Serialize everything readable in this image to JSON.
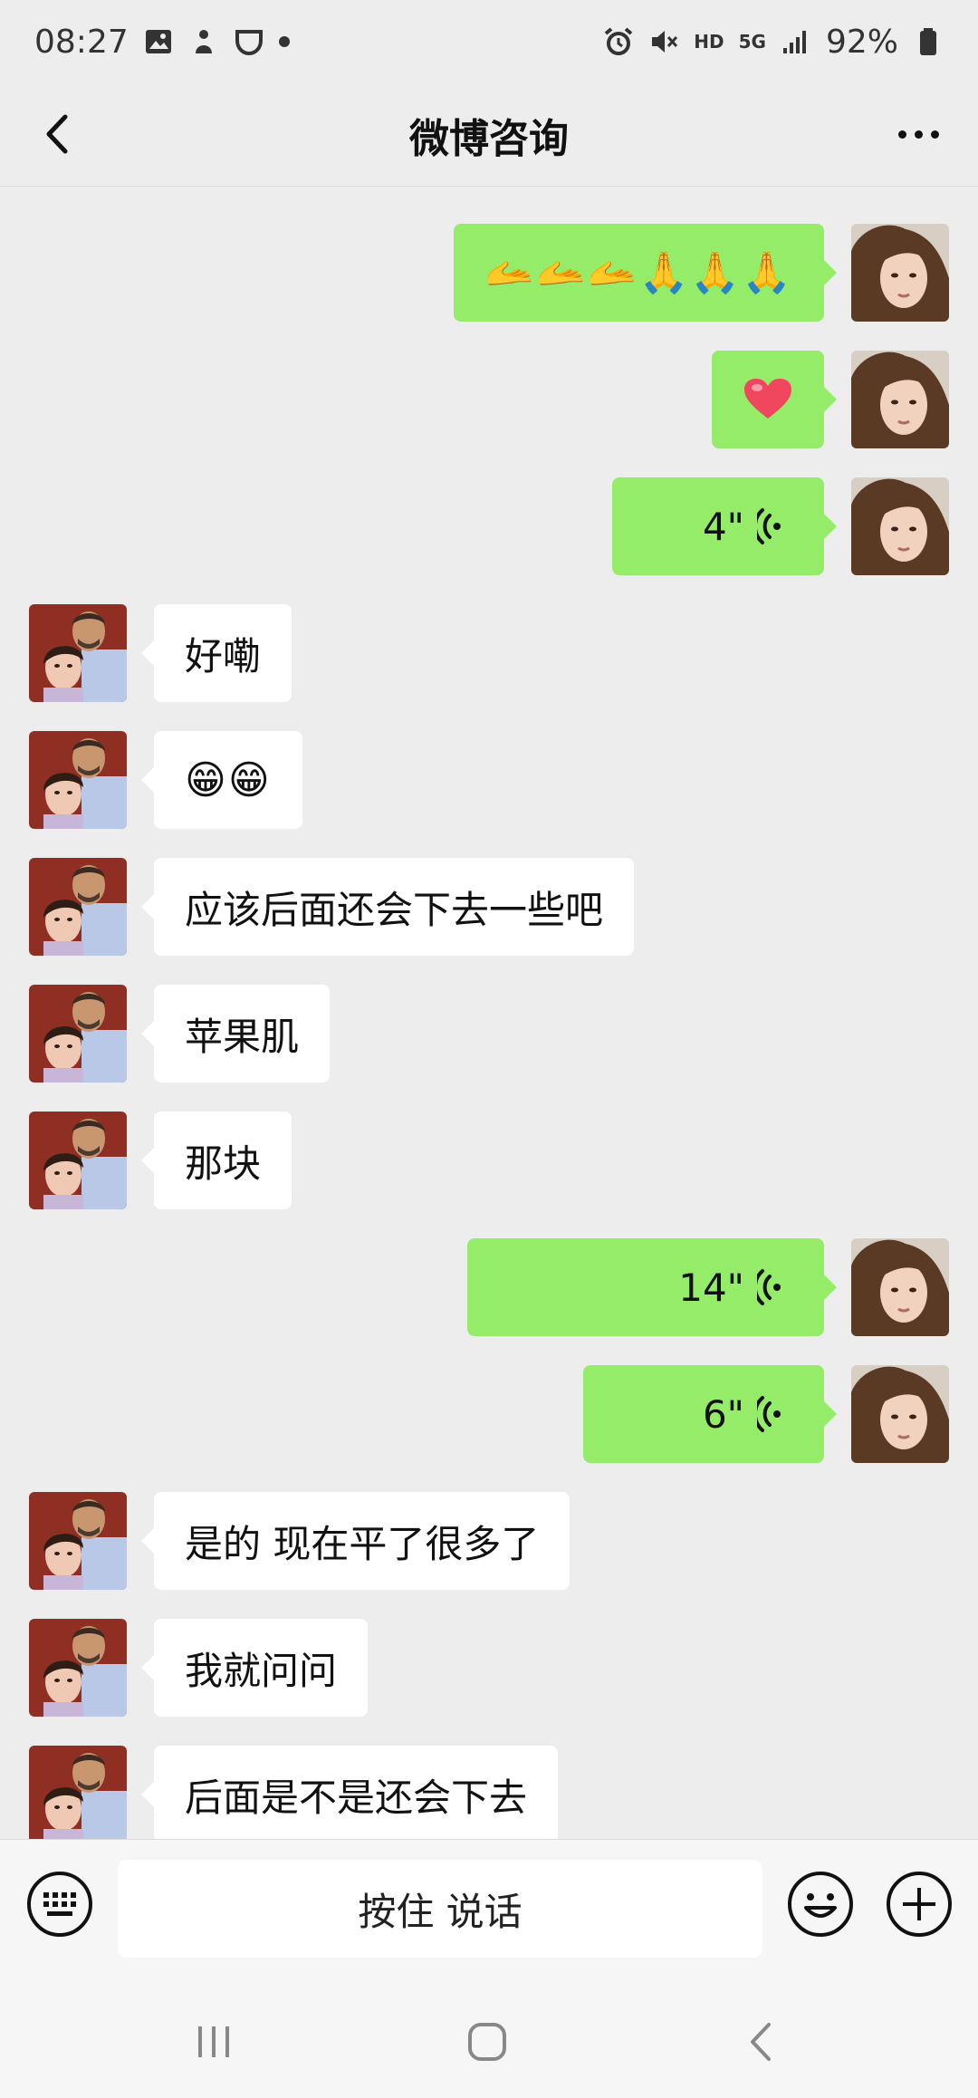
{
  "status_bar": {
    "time": "08:27",
    "network_hd": "HD",
    "network_5g": "5G",
    "battery": "92%",
    "icons_left": [
      "gallery-icon",
      "app-icon",
      "shield-icon",
      "dot-icon"
    ],
    "icons_right": [
      "alarm-icon",
      "mute-icon",
      "signal-icon",
      "battery-icon"
    ]
  },
  "header": {
    "title": "微博咨询",
    "back_icon": "chevron-left-icon",
    "more_icon": "more-dots-icon"
  },
  "messages": [
    {
      "side": "out",
      "type": "emoji",
      "text": "🫴🫴🫴🙏🙏🙏"
    },
    {
      "side": "out",
      "type": "heart",
      "text": ""
    },
    {
      "side": "out",
      "type": "voice",
      "text": "4\""
    },
    {
      "side": "in",
      "type": "text",
      "text": "好嘞"
    },
    {
      "side": "in",
      "type": "emoji",
      "text": "😁😁"
    },
    {
      "side": "in",
      "type": "text",
      "text": "应该后面还会下去一些吧"
    },
    {
      "side": "in",
      "type": "text",
      "text": "苹果肌"
    },
    {
      "side": "in",
      "type": "text",
      "text": "那块"
    },
    {
      "side": "out",
      "type": "voice",
      "text": "14\""
    },
    {
      "side": "out",
      "type": "voice",
      "text": "6\""
    },
    {
      "side": "in",
      "type": "text",
      "text": "是的 现在平了很多了"
    },
    {
      "side": "in",
      "type": "text",
      "text": "我就问问"
    },
    {
      "side": "in",
      "type": "text",
      "text": "后面是不是还会下去"
    }
  ],
  "input_bar": {
    "hold_to_talk": "按住 说话",
    "keyboard_icon": "keyboard-icon",
    "emoji_icon": "smiley-icon",
    "plus_icon": "plus-icon"
  },
  "system_nav": {
    "recent_icon": "recent-apps-icon",
    "home_icon": "home-icon",
    "back_icon": "back-icon"
  },
  "colors": {
    "outgoing_bubble": "#95ec69",
    "incoming_bubble": "#ffffff",
    "background": "#ededed"
  }
}
